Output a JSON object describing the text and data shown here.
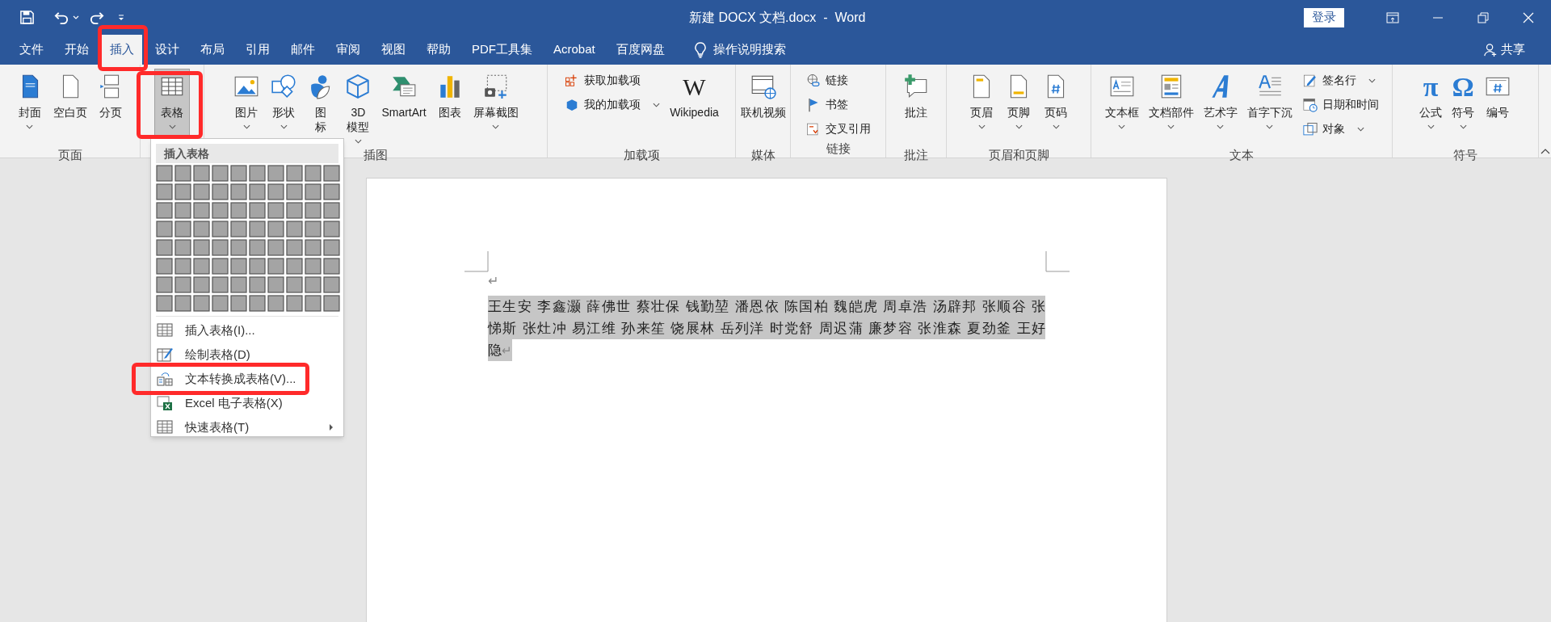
{
  "window": {
    "title": "新建 DOCX 文档.docx  -  Word",
    "sign_in": "登录"
  },
  "tabs": [
    {
      "label": "文件",
      "selected": false
    },
    {
      "label": "开始",
      "selected": false
    },
    {
      "label": "插入",
      "selected": true
    },
    {
      "label": "设计",
      "selected": false
    },
    {
      "label": "布局",
      "selected": false
    },
    {
      "label": "引用",
      "selected": false
    },
    {
      "label": "邮件",
      "selected": false
    },
    {
      "label": "审阅",
      "selected": false
    },
    {
      "label": "视图",
      "selected": false
    },
    {
      "label": "帮助",
      "selected": false
    },
    {
      "label": "PDF工具集",
      "selected": false
    },
    {
      "label": "Acrobat",
      "selected": false
    },
    {
      "label": "百度网盘",
      "selected": false
    }
  ],
  "tell_me": "操作说明搜索",
  "share": "共享",
  "ribbon": {
    "groups": [
      {
        "label": "页面",
        "buttons": [
          {
            "label": "封面",
            "kind": "large",
            "dropdown": true,
            "pressed": false
          },
          {
            "label": "空白页",
            "kind": "large",
            "dropdown": false,
            "pressed": false
          },
          {
            "label": "分页",
            "kind": "large",
            "dropdown": false,
            "pressed": false
          }
        ]
      },
      {
        "buttons": [
          {
            "label": "表格",
            "kind": "large",
            "dropdown": true,
            "pressed": true
          }
        ]
      },
      {
        "label": "插图",
        "buttons": [
          {
            "label": "图片",
            "kind": "large",
            "dropdown": true,
            "pressed": false
          },
          {
            "label": "形状",
            "kind": "large",
            "dropdown": true,
            "pressed": false
          },
          {
            "lines": [
              "图",
              "标"
            ],
            "kind": "large",
            "dropdown": false,
            "pressed": false
          },
          {
            "lines": [
              "3D",
              "模型"
            ],
            "kind": "large",
            "dropdown": true,
            "pressed": false
          },
          {
            "label": "SmartArt",
            "kind": "large",
            "dropdown": false,
            "pressed": false
          },
          {
            "label": "图表",
            "kind": "large",
            "dropdown": false,
            "pressed": false
          },
          {
            "label": "屏幕截图",
            "kind": "large",
            "dropdown": true,
            "pressed": false
          }
        ]
      },
      {
        "label": "加载项",
        "buttons": [
          {
            "label": "获取加载项",
            "kind": "small",
            "dropdown": false,
            "pressed": false
          },
          {
            "label": "我的加载项",
            "kind": "small",
            "dropdown": true,
            "pressed": false
          },
          {
            "label": "Wikipedia",
            "kind": "large",
            "dropdown": false,
            "pressed": false,
            "glyph": "W"
          }
        ]
      },
      {
        "label": "媒体",
        "buttons": [
          {
            "label": "联机视频",
            "kind": "large",
            "dropdown": false,
            "pressed": false
          }
        ]
      },
      {
        "label": "链接",
        "buttons": [
          {
            "label": "链接",
            "kind": "small",
            "dropdown": false,
            "pressed": false
          },
          {
            "label": "书签",
            "kind": "small",
            "dropdown": false,
            "pressed": false
          },
          {
            "label": "交叉引用",
            "kind": "small",
            "dropdown": false,
            "pressed": false
          }
        ]
      },
      {
        "label": "批注",
        "buttons": [
          {
            "label": "批注",
            "kind": "large",
            "dropdown": false,
            "pressed": false
          }
        ]
      },
      {
        "label": "页眉和页脚",
        "buttons": [
          {
            "label": "页眉",
            "kind": "large",
            "dropdown": true,
            "pressed": false
          },
          {
            "label": "页脚",
            "kind": "large",
            "dropdown": true,
            "pressed": false
          },
          {
            "label": "页码",
            "kind": "large",
            "dropdown": true,
            "pressed": false
          }
        ]
      },
      {
        "label": "文本",
        "buttons": [
          {
            "label": "文本框",
            "kind": "large",
            "dropdown": true,
            "pressed": false
          },
          {
            "label": "文档部件",
            "kind": "large",
            "dropdown": true,
            "pressed": false
          },
          {
            "label": "艺术字",
            "kind": "large",
            "dropdown": true,
            "pressed": false
          },
          {
            "label": "首字下沉",
            "kind": "large",
            "dropdown": true,
            "pressed": false
          },
          {
            "label": "签名行",
            "kind": "small",
            "dropdown": true,
            "pressed": false
          },
          {
            "label": "日期和时间",
            "kind": "small",
            "dropdown": false,
            "pressed": false
          },
          {
            "label": "对象",
            "kind": "small",
            "dropdown": true,
            "pressed": false
          }
        ]
      },
      {
        "label": "符号",
        "buttons": [
          {
            "label": "公式",
            "kind": "large",
            "dropdown": true,
            "pressed": false,
            "glyph": "π"
          },
          {
            "label": "符号",
            "kind": "large",
            "dropdown": true,
            "pressed": false,
            "glyph": "Ω"
          },
          {
            "label": "编号",
            "kind": "large",
            "dropdown": false,
            "pressed": false
          }
        ]
      }
    ]
  },
  "table_menu": {
    "header": "插入表格",
    "items": [
      {
        "label": "插入表格(I)...",
        "submenu": false
      },
      {
        "label": "绘制表格(D)",
        "submenu": false
      },
      {
        "label": "文本转换成表格(V)...",
        "submenu": false
      },
      {
        "label": "Excel 电子表格(X)",
        "submenu": false
      },
      {
        "label": "快速表格(T)",
        "submenu": true
      }
    ]
  },
  "document": {
    "empty_paragraph_mark": "↵",
    "paragraph": {
      "lines": [
        "王生安 李鑫灏 薛佛世 蔡壮保 钱勤堃 潘恩依 陈国柏 魏皑虎 周卓浩 汤辟邦 张顺谷 张",
        "悌斯 张灶冲 易江维 孙来笙 饶展林 岳列洋 时党舒 周迟蒲 廉梦容 张淮森 夏劲釜 王好",
        "隐"
      ],
      "selected": true,
      "mark": "↵"
    }
  }
}
